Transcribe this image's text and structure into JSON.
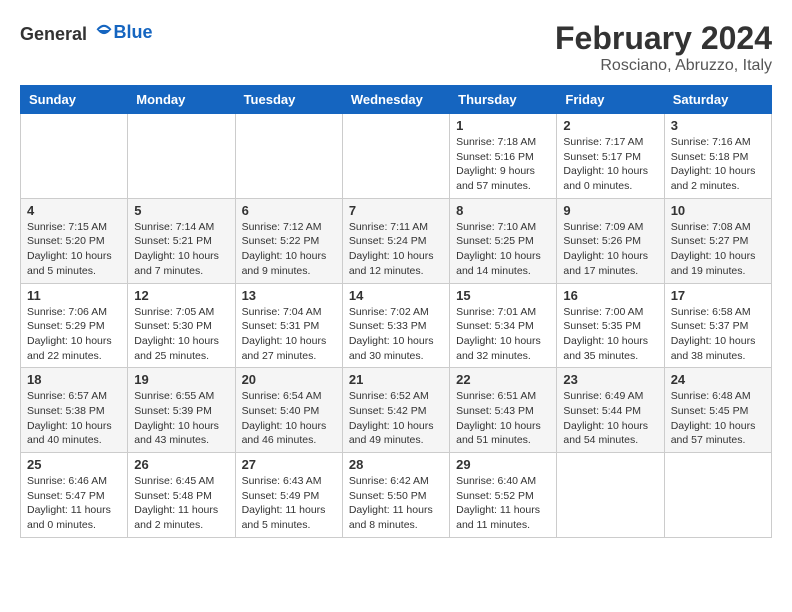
{
  "header": {
    "logo_general": "General",
    "logo_blue": "Blue",
    "month": "February 2024",
    "location": "Rosciano, Abruzzo, Italy"
  },
  "days_of_week": [
    "Sunday",
    "Monday",
    "Tuesday",
    "Wednesday",
    "Thursday",
    "Friday",
    "Saturday"
  ],
  "weeks": [
    [
      {
        "day": "",
        "info": ""
      },
      {
        "day": "",
        "info": ""
      },
      {
        "day": "",
        "info": ""
      },
      {
        "day": "",
        "info": ""
      },
      {
        "day": "1",
        "info": "Sunrise: 7:18 AM\nSunset: 5:16 PM\nDaylight: 9 hours\nand 57 minutes."
      },
      {
        "day": "2",
        "info": "Sunrise: 7:17 AM\nSunset: 5:17 PM\nDaylight: 10 hours\nand 0 minutes."
      },
      {
        "day": "3",
        "info": "Sunrise: 7:16 AM\nSunset: 5:18 PM\nDaylight: 10 hours\nand 2 minutes."
      }
    ],
    [
      {
        "day": "4",
        "info": "Sunrise: 7:15 AM\nSunset: 5:20 PM\nDaylight: 10 hours\nand 5 minutes."
      },
      {
        "day": "5",
        "info": "Sunrise: 7:14 AM\nSunset: 5:21 PM\nDaylight: 10 hours\nand 7 minutes."
      },
      {
        "day": "6",
        "info": "Sunrise: 7:12 AM\nSunset: 5:22 PM\nDaylight: 10 hours\nand 9 minutes."
      },
      {
        "day": "7",
        "info": "Sunrise: 7:11 AM\nSunset: 5:24 PM\nDaylight: 10 hours\nand 12 minutes."
      },
      {
        "day": "8",
        "info": "Sunrise: 7:10 AM\nSunset: 5:25 PM\nDaylight: 10 hours\nand 14 minutes."
      },
      {
        "day": "9",
        "info": "Sunrise: 7:09 AM\nSunset: 5:26 PM\nDaylight: 10 hours\nand 17 minutes."
      },
      {
        "day": "10",
        "info": "Sunrise: 7:08 AM\nSunset: 5:27 PM\nDaylight: 10 hours\nand 19 minutes."
      }
    ],
    [
      {
        "day": "11",
        "info": "Sunrise: 7:06 AM\nSunset: 5:29 PM\nDaylight: 10 hours\nand 22 minutes."
      },
      {
        "day": "12",
        "info": "Sunrise: 7:05 AM\nSunset: 5:30 PM\nDaylight: 10 hours\nand 25 minutes."
      },
      {
        "day": "13",
        "info": "Sunrise: 7:04 AM\nSunset: 5:31 PM\nDaylight: 10 hours\nand 27 minutes."
      },
      {
        "day": "14",
        "info": "Sunrise: 7:02 AM\nSunset: 5:33 PM\nDaylight: 10 hours\nand 30 minutes."
      },
      {
        "day": "15",
        "info": "Sunrise: 7:01 AM\nSunset: 5:34 PM\nDaylight: 10 hours\nand 32 minutes."
      },
      {
        "day": "16",
        "info": "Sunrise: 7:00 AM\nSunset: 5:35 PM\nDaylight: 10 hours\nand 35 minutes."
      },
      {
        "day": "17",
        "info": "Sunrise: 6:58 AM\nSunset: 5:37 PM\nDaylight: 10 hours\nand 38 minutes."
      }
    ],
    [
      {
        "day": "18",
        "info": "Sunrise: 6:57 AM\nSunset: 5:38 PM\nDaylight: 10 hours\nand 40 minutes."
      },
      {
        "day": "19",
        "info": "Sunrise: 6:55 AM\nSunset: 5:39 PM\nDaylight: 10 hours\nand 43 minutes."
      },
      {
        "day": "20",
        "info": "Sunrise: 6:54 AM\nSunset: 5:40 PM\nDaylight: 10 hours\nand 46 minutes."
      },
      {
        "day": "21",
        "info": "Sunrise: 6:52 AM\nSunset: 5:42 PM\nDaylight: 10 hours\nand 49 minutes."
      },
      {
        "day": "22",
        "info": "Sunrise: 6:51 AM\nSunset: 5:43 PM\nDaylight: 10 hours\nand 51 minutes."
      },
      {
        "day": "23",
        "info": "Sunrise: 6:49 AM\nSunset: 5:44 PM\nDaylight: 10 hours\nand 54 minutes."
      },
      {
        "day": "24",
        "info": "Sunrise: 6:48 AM\nSunset: 5:45 PM\nDaylight: 10 hours\nand 57 minutes."
      }
    ],
    [
      {
        "day": "25",
        "info": "Sunrise: 6:46 AM\nSunset: 5:47 PM\nDaylight: 11 hours\nand 0 minutes."
      },
      {
        "day": "26",
        "info": "Sunrise: 6:45 AM\nSunset: 5:48 PM\nDaylight: 11 hours\nand 2 minutes."
      },
      {
        "day": "27",
        "info": "Sunrise: 6:43 AM\nSunset: 5:49 PM\nDaylight: 11 hours\nand 5 minutes."
      },
      {
        "day": "28",
        "info": "Sunrise: 6:42 AM\nSunset: 5:50 PM\nDaylight: 11 hours\nand 8 minutes."
      },
      {
        "day": "29",
        "info": "Sunrise: 6:40 AM\nSunset: 5:52 PM\nDaylight: 11 hours\nand 11 minutes."
      },
      {
        "day": "",
        "info": ""
      },
      {
        "day": "",
        "info": ""
      }
    ]
  ]
}
